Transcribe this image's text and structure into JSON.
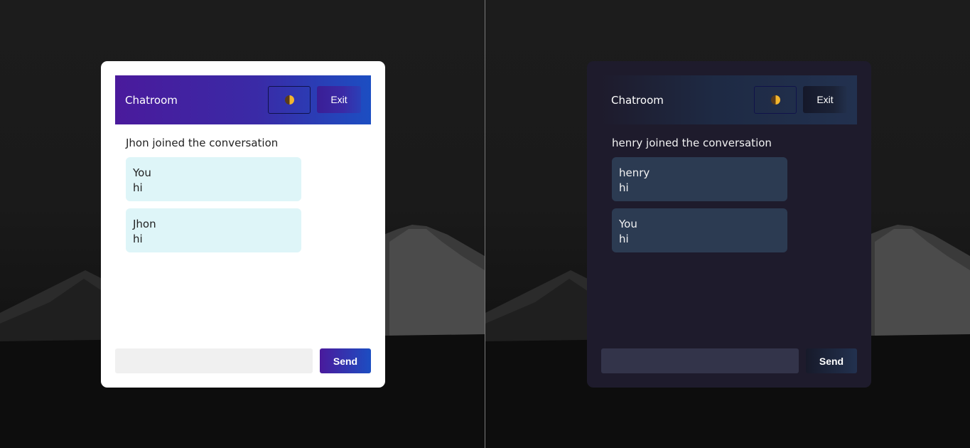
{
  "panels": [
    {
      "theme": "light",
      "header": {
        "title": "Chatroom",
        "theme_toggle_icon": "half-moon-icon",
        "exit_label": "Exit"
      },
      "join_notice": "Jhon joined the conversation",
      "messages": [
        {
          "sender": "You",
          "text": "hi"
        },
        {
          "sender": "Jhon",
          "text": "hi"
        }
      ],
      "composer": {
        "input_value": "",
        "placeholder": "",
        "send_label": "Send"
      }
    },
    {
      "theme": "dark",
      "header": {
        "title": "Chatroom",
        "theme_toggle_icon": "half-moon-icon",
        "exit_label": "Exit"
      },
      "join_notice": "henry joined the conversation",
      "messages": [
        {
          "sender": "henry",
          "text": "hi"
        },
        {
          "sender": "You",
          "text": "hi"
        }
      ],
      "composer": {
        "input_value": "",
        "placeholder": "",
        "send_label": "Send"
      }
    }
  ],
  "colors": {
    "light_header_gradient_start": "#4a1a9c",
    "light_header_gradient_end": "#1c4ec2",
    "light_message_bubble": "#def5f8",
    "dark_card_background": "#1e1b2c",
    "dark_message_bubble": "#2c3b52",
    "toggle_icon_accent": "#f2b62e"
  }
}
